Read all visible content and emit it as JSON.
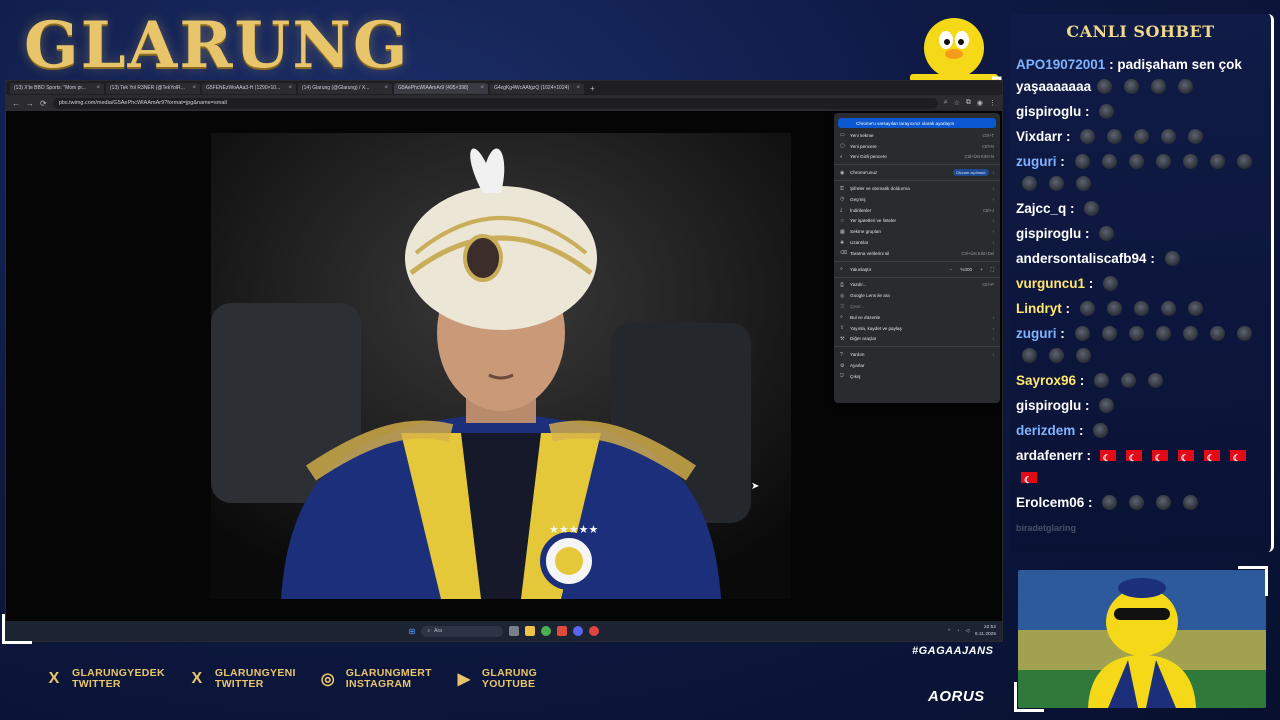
{
  "brand": {
    "title": "GLARUNG"
  },
  "browser": {
    "tabs": [
      {
        "title": "(13) X'te BBO Sports: \"Mom pr..."
      },
      {
        "title": "(13) Tek Yol R3NER (@TekYolR..."
      },
      {
        "title": "G5FENEzWoAAa3-H (1290×10..."
      },
      {
        "title": "(14) Glarung (@Glarung) / X..."
      },
      {
        "title": "G5AePhcWIAAmAr9 (495×398)",
        "active": true
      },
      {
        "title": "G4xgKg4WcAAfgzQ (1024×1024)"
      }
    ],
    "url": "pbs.twimg.com/media/G5AePhcWIAAmAr9?format=jpg&name=small"
  },
  "menu": {
    "highlight": "Chrome'u varsayılan tarayıcınız olarak ayarlayın",
    "items": [
      {
        "icon": "new-tab-icon",
        "label": "Yeni sekme",
        "shortcut": "Ctrl+T"
      },
      {
        "icon": "new-window-icon",
        "label": "Yeni pencere",
        "shortcut": "Ctrl+N"
      },
      {
        "icon": "incognito-icon",
        "label": "Yeni Gizli pencere",
        "shortcut": "Ctrl+Üst Krkt+N"
      },
      {
        "sep": true
      },
      {
        "icon": "profile-icon",
        "label": "Chrome'unuz",
        "pill": "Oturum açılmadı",
        "arrow": true
      },
      {
        "sep": true
      },
      {
        "icon": "key-icon",
        "label": "Şifreler ve otomatik doldurma",
        "arrow": true
      },
      {
        "icon": "history-icon",
        "label": "Geçmiş",
        "arrow": true
      },
      {
        "icon": "download-icon",
        "label": "İndirilenler",
        "shortcut": "Ctrl+J"
      },
      {
        "icon": "bookmark-icon",
        "label": "Yer işaretleri ve listeler",
        "arrow": true
      },
      {
        "icon": "tabgroup-icon",
        "label": "Sekme grupları",
        "arrow": true
      },
      {
        "icon": "extension-icon",
        "label": "Uzantılar",
        "arrow": true
      },
      {
        "icon": "trash-icon",
        "label": "Tarama verilerini sil",
        "shortcut": "Ctrl+Üst Krkt+Del"
      },
      {
        "sep": true
      },
      {
        "icon": "zoom-icon",
        "label": "Yakınlaştır",
        "zoom": "%300"
      },
      {
        "sep": true
      },
      {
        "icon": "print-icon",
        "label": "Yazdır...",
        "shortcut": "Ctrl+P"
      },
      {
        "icon": "lens-icon",
        "label": "Google Lens ile ara"
      },
      {
        "icon": "translate-icon",
        "label": "Çevir...",
        "dim": true
      },
      {
        "icon": "find-icon",
        "label": "Bul ve düzenle",
        "arrow": true
      },
      {
        "icon": "share-icon",
        "label": "Yayınla, kaydet ve paylaş",
        "arrow": true
      },
      {
        "icon": "tools-icon",
        "label": "Diğer araçlar",
        "arrow": true
      },
      {
        "sep": true
      },
      {
        "icon": "help-icon",
        "label": "Yardım",
        "arrow": true
      },
      {
        "icon": "settings-icon",
        "label": "Ayarlar"
      },
      {
        "icon": "exit-icon",
        "label": "Çıkış"
      }
    ]
  },
  "taskbar": {
    "search": "Ara",
    "time": "22:52",
    "date": "6.11.2025"
  },
  "chat": {
    "title": "CANLI SOHBET",
    "messages": [
      {
        "user": "APO19072001",
        "color": "#7fb2ff",
        "text": "padişaham sen çok yaşaaaaaaa",
        "emotes": 4,
        "text_after": true
      },
      {
        "user": "gispiroglu",
        "color": "#ffffff",
        "emotes": 1
      },
      {
        "user": "Vixdarr",
        "color": "#ffffff",
        "emotes": 5
      },
      {
        "user": "zuguri",
        "color": "#7fb2ff",
        "emotes": 10
      },
      {
        "user": "Zajcc_q",
        "color": "#ffffff",
        "emotes": 1
      },
      {
        "user": "gispiroglu",
        "color": "#ffffff",
        "emotes": 1
      },
      {
        "user": "andersontaliscafb94",
        "color": "#ffffff",
        "emotes": 1
      },
      {
        "user": "vurguncu1",
        "color": "#ffe66d",
        "emotes": 1
      },
      {
        "user": "Lindryt",
        "color": "#ffe66d",
        "emotes": 5
      },
      {
        "user": "zuguri",
        "color": "#7fb2ff",
        "emotes": 10
      },
      {
        "user": "Sayrox96",
        "color": "#ffe66d",
        "emotes": 3
      },
      {
        "user": "gispiroglu",
        "color": "#ffffff",
        "emotes": 1
      },
      {
        "user": "derizdem",
        "color": "#7fb2ff",
        "emotes": 1
      },
      {
        "user": "ardafenerr",
        "color": "#ffffff",
        "flags": 7
      },
      {
        "user": "Erolcem06",
        "color": "#ffffff",
        "emotes": 4
      }
    ],
    "faded_user": "biradetglaring"
  },
  "socials": [
    {
      "icon": "x-icon",
      "line1": "GLARUNGYEDEK",
      "line2": "TWITTER"
    },
    {
      "icon": "x-icon",
      "line1": "GLARUNGYENI",
      "line2": "TWITTER"
    },
    {
      "icon": "instagram-icon",
      "line1": "GLARUNGMERT",
      "line2": "INSTAGRAM"
    },
    {
      "icon": "youtube-icon",
      "line1": "GLARUNG",
      "line2": "YOUTUBE"
    }
  ],
  "hashtag": "#GAGAAJANS",
  "sponsor": "AORUS",
  "colors": {
    "gold": "#e8c56a",
    "navy": "#0e1a44",
    "menu_highlight": "#0b57d0"
  }
}
